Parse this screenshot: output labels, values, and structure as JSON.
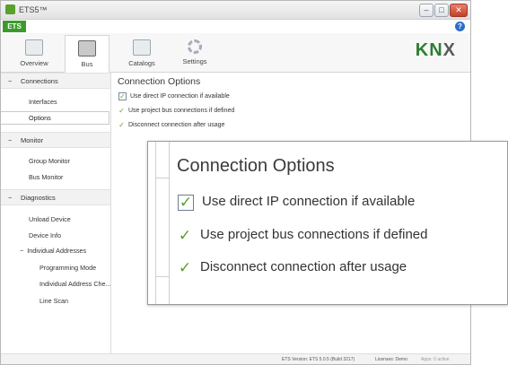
{
  "window": {
    "title": "ETS5™"
  },
  "etsbar": {
    "tab": "ETS",
    "help": "?"
  },
  "ribbon": {
    "tabs": [
      {
        "label": "Overview",
        "icon": "overview-icon"
      },
      {
        "label": "Bus",
        "icon": "bus-icon"
      },
      {
        "label": "Catalogs",
        "icon": "catalogs-icon"
      },
      {
        "label": "Settings",
        "icon": "settings-gear-icon"
      }
    ],
    "logo": {
      "kn": "KN",
      "x": "X"
    }
  },
  "sidebar": {
    "sections": [
      {
        "label": "Connections",
        "toggle": "−"
      },
      {
        "label": "Monitor",
        "toggle": "−"
      },
      {
        "label": "Diagnostics",
        "toggle": "−"
      }
    ],
    "connections_items": [
      "Interfaces",
      "Options"
    ],
    "monitor_items": [
      "Group Monitor",
      "Bus Monitor"
    ],
    "diagnostics_items": [
      "Unload Device",
      "Device Info"
    ],
    "individual_addresses": {
      "label": "Individual Addresses",
      "toggle": "−",
      "items": [
        "Programming Mode",
        "Individual Address Che...",
        "Line Scan"
      ]
    }
  },
  "main": {
    "title": "Connection Options",
    "options": [
      {
        "label": "Use direct IP connection if available",
        "checked": true
      },
      {
        "label": "Use project bus connections if defined",
        "checked": true
      },
      {
        "label": "Disconnect connection after usage",
        "checked": true
      }
    ]
  },
  "statusbar": {
    "version": "ETS Version: ETS 5.0.5 (Build 3217)",
    "license": "Licenses: Demo",
    "apps": "Apps: 0 active"
  },
  "zoom": {
    "title": "Connection Options",
    "options": [
      "Use direct IP connection if available",
      "Use project bus connections if defined",
      "Disconnect connection after usage"
    ]
  },
  "colors": {
    "accent": "#3c9a2c",
    "check": "#5aa02c"
  }
}
